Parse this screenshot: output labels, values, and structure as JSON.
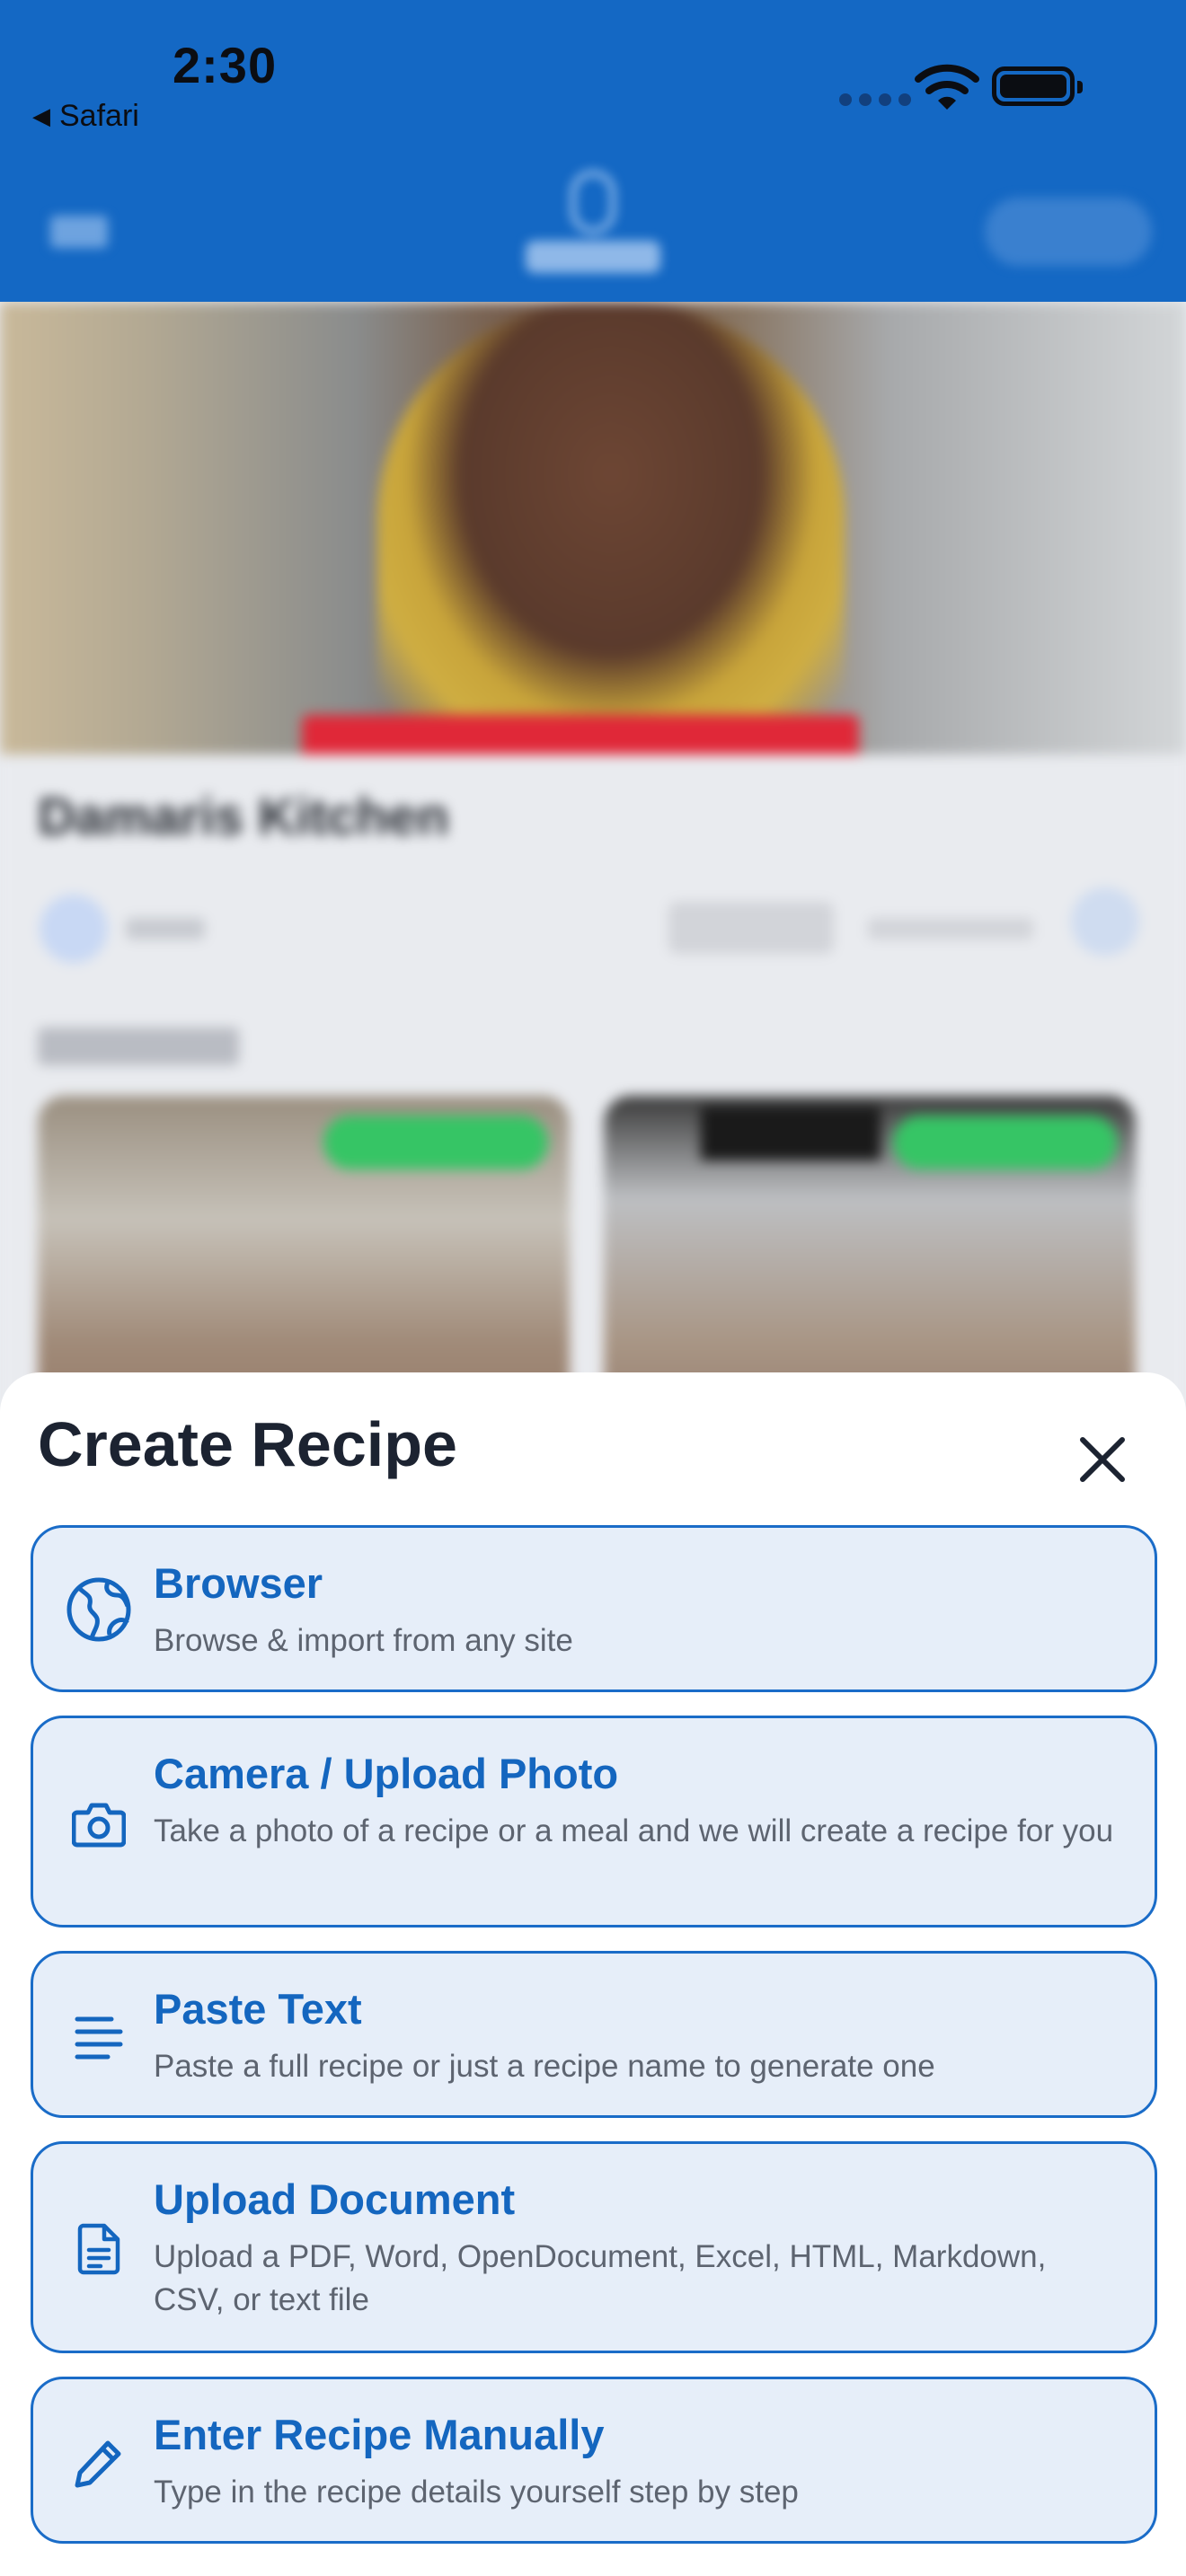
{
  "status_bar": {
    "time": "2:30",
    "back_app": "Safari",
    "back_icon": "triangle-left-icon",
    "wifi_icon": "wifi-icon",
    "battery_icon": "battery-icon"
  },
  "blurred_page": {
    "title": "Damaris Kitchen"
  },
  "sheet": {
    "title": "Create Recipe",
    "close_icon": "close-icon",
    "options": [
      {
        "title": "Browser",
        "description": "Browse & import from any site",
        "icon": "globe-icon"
      },
      {
        "title": "Camera / Upload Photo",
        "description": "Take a photo of a recipe or a meal and we will create a recipe for you",
        "icon": "camera-icon"
      },
      {
        "title": "Paste Text",
        "description": "Paste a full recipe or just a recipe name to generate one",
        "icon": "text-lines-icon"
      },
      {
        "title": "Upload Document",
        "description": "Upload a PDF, Word, OpenDocument, Excel, HTML, Markdown, CSV, or text file",
        "icon": "document-icon"
      },
      {
        "title": "Enter Recipe Manually",
        "description": "Type in the recipe details yourself step by step",
        "icon": "pencil-icon"
      }
    ]
  },
  "colors": {
    "header_blue": "#1468c4",
    "option_border": "#1a6cc8",
    "option_background": "#e6eef9",
    "option_title": "#1466bf",
    "option_description": "#5d6470"
  }
}
